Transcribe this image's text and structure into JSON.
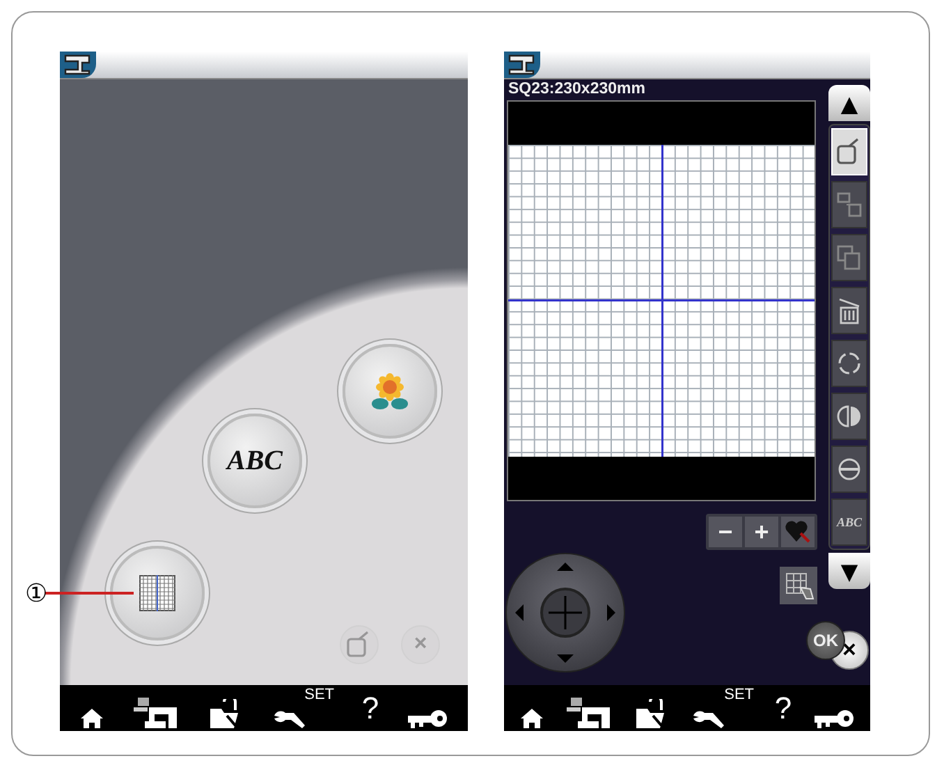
{
  "callout": {
    "label": "①"
  },
  "left_screen": {
    "menu_buttons": [
      {
        "kind": "flower"
      },
      {
        "kind": "text",
        "label": "ABC"
      },
      {
        "kind": "grid"
      }
    ],
    "corner_buttons": [
      {
        "kind": "edit",
        "disabled": true
      },
      {
        "kind": "close",
        "label": "×",
        "disabled": true
      }
    ],
    "toolbar": [
      {
        "kind": "home"
      },
      {
        "kind": "machine"
      },
      {
        "kind": "folder"
      },
      {
        "kind": "settings",
        "label": "SET"
      },
      {
        "kind": "help",
        "label": "?"
      },
      {
        "kind": "key"
      }
    ]
  },
  "right_screen": {
    "hoop_label": "SQ23:230x230mm",
    "scroll_up": "▲",
    "scroll_down": "▼",
    "tools": [
      {
        "kind": "edit",
        "selected": true
      },
      {
        "kind": "group",
        "selected": false
      },
      {
        "kind": "copy",
        "selected": false
      },
      {
        "kind": "delete",
        "selected": false
      },
      {
        "kind": "rotate",
        "selected": false
      },
      {
        "kind": "flip_h",
        "selected": false
      },
      {
        "kind": "flip_v",
        "selected": false
      },
      {
        "kind": "arc",
        "label": "ABC",
        "selected": false
      }
    ],
    "zoom_buttons": [
      {
        "kind": "minus",
        "label": "−"
      },
      {
        "kind": "plus",
        "label": "+"
      },
      {
        "kind": "heart"
      }
    ],
    "ok": "OK",
    "close": "×",
    "toolbar": [
      {
        "kind": "home"
      },
      {
        "kind": "machine"
      },
      {
        "kind": "folder"
      },
      {
        "kind": "settings",
        "label": "SET"
      },
      {
        "kind": "help",
        "label": "?"
      },
      {
        "kind": "key"
      }
    ]
  }
}
